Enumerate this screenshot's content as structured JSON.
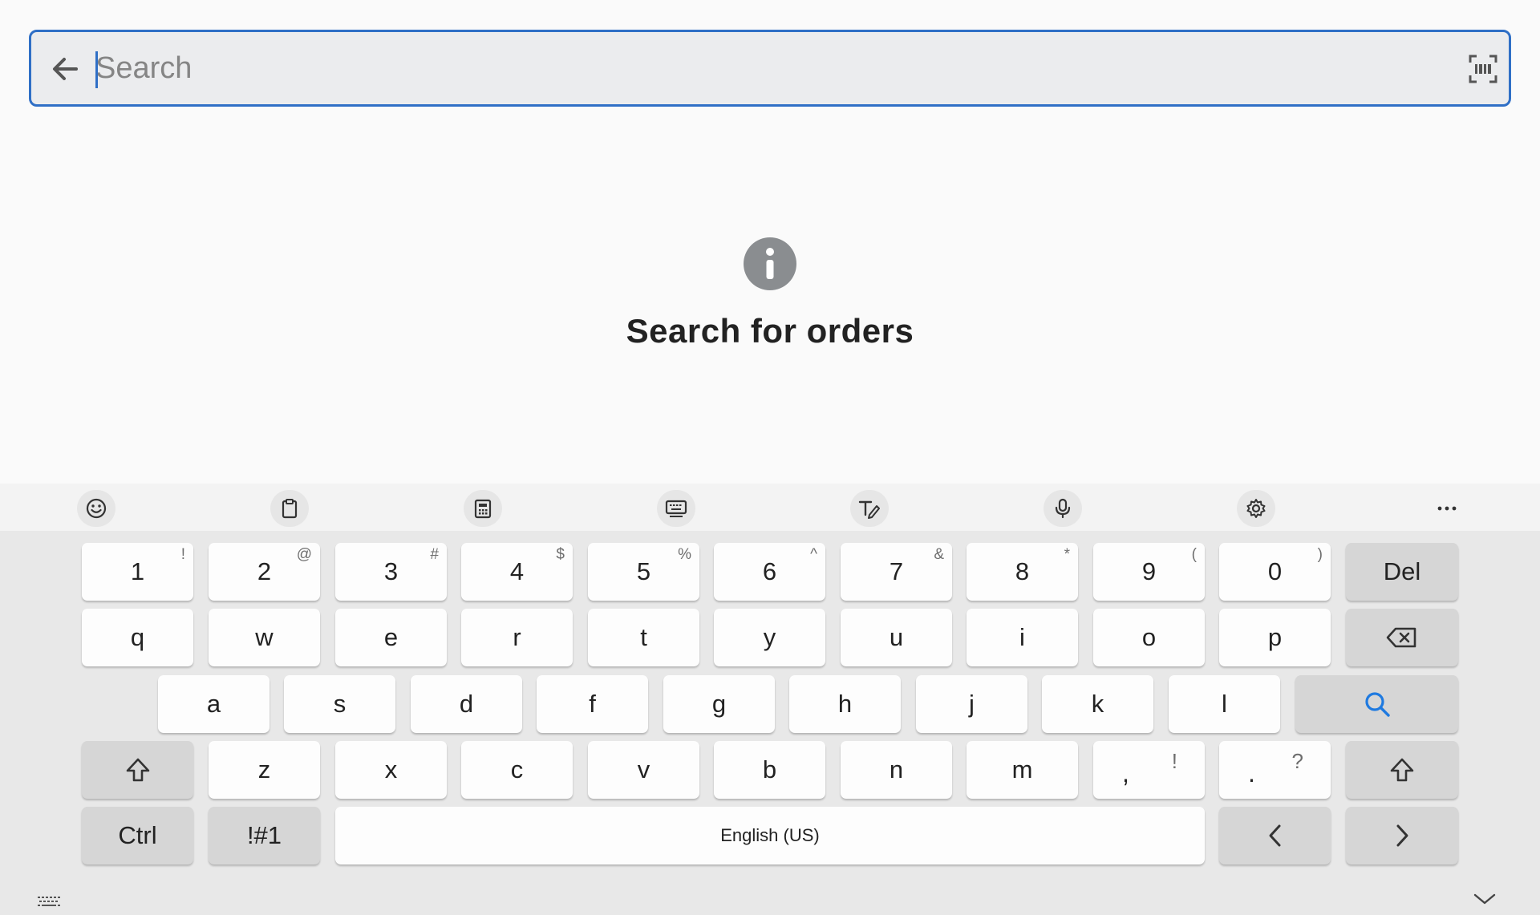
{
  "search": {
    "placeholder": "Search",
    "value": ""
  },
  "icons": {
    "back": "arrow-left-icon",
    "scan": "barcode-scan-icon",
    "info": "info-icon"
  },
  "empty_state": {
    "title": "Search for orders"
  },
  "keyboard_toolbar": {
    "items": [
      "emoji-icon",
      "clipboard-icon",
      "numeric-keypad-icon",
      "keyboard-mode-icon",
      "handwriting-icon",
      "microphone-icon",
      "settings-icon",
      "more-icon"
    ]
  },
  "keyboard": {
    "row1": [
      {
        "main": "1",
        "sub": "!"
      },
      {
        "main": "2",
        "sub": "@"
      },
      {
        "main": "3",
        "sub": "#"
      },
      {
        "main": "4",
        "sub": "$"
      },
      {
        "main": "5",
        "sub": "%"
      },
      {
        "main": "6",
        "sub": "^"
      },
      {
        "main": "7",
        "sub": "&"
      },
      {
        "main": "8",
        "sub": "*"
      },
      {
        "main": "9",
        "sub": "("
      },
      {
        "main": "0",
        "sub": ")"
      }
    ],
    "del": "Del",
    "row2": [
      "q",
      "w",
      "e",
      "r",
      "t",
      "y",
      "u",
      "i",
      "o",
      "p"
    ],
    "row3": [
      "a",
      "s",
      "d",
      "f",
      "g",
      "h",
      "j",
      "k",
      "l"
    ],
    "row4": [
      "z",
      "x",
      "c",
      "v",
      "b",
      "n",
      "m"
    ],
    "comma": {
      "main": ",",
      "sub": "!"
    },
    "period": {
      "main": ".",
      "sub": "?"
    },
    "ctrl": "Ctrl",
    "symbols": "!#1",
    "space": "English (US)",
    "colors": {
      "accent": "#2f6fc6",
      "search_key_icon": "#1f7ae0"
    }
  }
}
